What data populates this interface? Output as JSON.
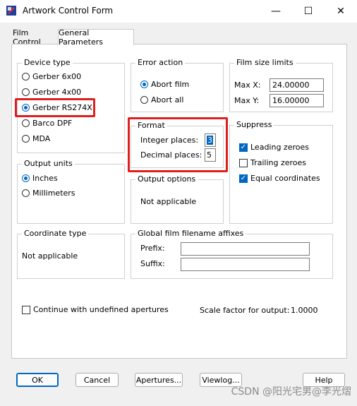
{
  "window": {
    "title": "Artwork Control Form",
    "controls": {
      "minimize": "—",
      "maximize": "☐",
      "close": "✕"
    }
  },
  "tabs": [
    {
      "label": "Film Control",
      "active": false
    },
    {
      "label": "General Parameters",
      "active": true
    }
  ],
  "device_type": {
    "legend": "Device type",
    "options": [
      "Gerber 6x00",
      "Gerber 4x00",
      "Gerber RS274X",
      "Barco DPF",
      "MDA"
    ],
    "selected": "Gerber RS274X"
  },
  "error_action": {
    "legend": "Error action",
    "options": [
      "Abort film",
      "Abort all"
    ],
    "selected": "Abort film"
  },
  "film_size": {
    "legend": "Film size limits",
    "max_x_label": "Max X:",
    "max_x": "24.00000",
    "max_y_label": "Max Y:",
    "max_y": "16.00000"
  },
  "format": {
    "legend": "Format",
    "integer_label": "Integer places:",
    "integer_value": "3",
    "decimal_label": "Decimal places:",
    "decimal_value": "5"
  },
  "suppress": {
    "legend": "Suppress",
    "leading": {
      "label": "Leading zeroes",
      "checked": true
    },
    "trailing": {
      "label": "Trailing zeroes",
      "checked": false
    },
    "equal": {
      "label": "Equal coordinates",
      "checked": true
    }
  },
  "output_units": {
    "legend": "Output units",
    "options": [
      "Inches",
      "Millimeters"
    ],
    "selected": "Inches"
  },
  "output_options": {
    "legend": "Output options",
    "text": "Not applicable"
  },
  "coordinate_type": {
    "legend": "Coordinate type",
    "text": "Not applicable"
  },
  "global_affixes": {
    "legend": "Global film filename affixes",
    "prefix_label": "Prefix:",
    "prefix_value": "",
    "suffix_label": "Suffix:",
    "suffix_value": ""
  },
  "continue_undefined": {
    "label": "Continue with undefined apertures",
    "checked": false
  },
  "scale_factor": {
    "label": "Scale factor for output:",
    "value": "1.0000"
  },
  "buttons": {
    "ok": "OK",
    "cancel": "Cancel",
    "apertures": "Apertures...",
    "viewlog": "Viewlog...",
    "help": "Help"
  },
  "watermark": "CSDN @阳光宅男@李光熠",
  "colors": {
    "highlight": "#e01e1e",
    "accent": "#0067c0"
  }
}
